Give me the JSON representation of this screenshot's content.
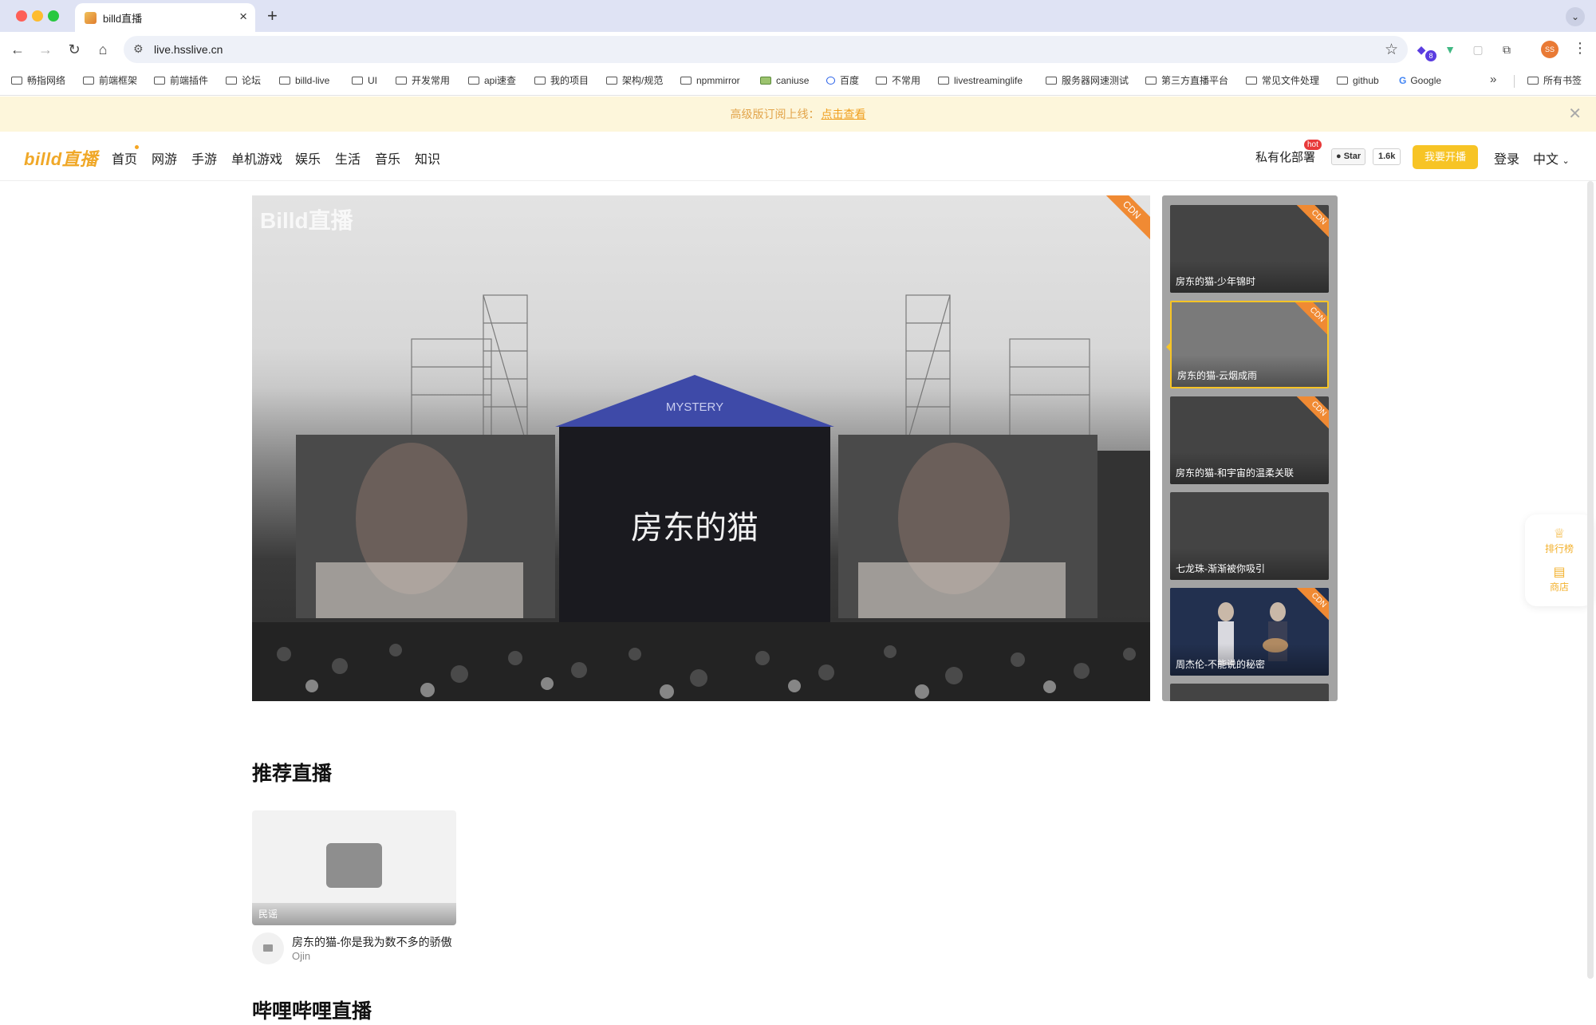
{
  "browser": {
    "tab_title": "billd直播",
    "url": "live.hsslive.cn",
    "ext_badge": "8",
    "profile_initials": "SS",
    "bookmarks": [
      "畅指网络",
      "前端框架",
      "前端插件",
      "论坛",
      "billd-live",
      "UI",
      "开发常用",
      "api速查",
      "我的项目",
      "架构/规范",
      "npmmirror",
      "caniuse",
      "百度",
      "不常用",
      "livestreaminglife",
      "服务器网速测试",
      "第三方直播平台",
      "常见文件处理",
      "github",
      "Google"
    ],
    "all_bookmarks": "所有书签"
  },
  "notice": {
    "text": "高级版订阅上线：",
    "link": "点击查看"
  },
  "header": {
    "logo": "billd直播",
    "nav": [
      "首页",
      "网游",
      "手游",
      "单机游戏",
      "娱乐",
      "生活",
      "音乐",
      "知识"
    ],
    "private_deploy": "私有化部署",
    "hot": "hot",
    "github_star": "Star",
    "github_count": "1.6k",
    "go_live": "我要开播",
    "login": "登录",
    "language": "中文"
  },
  "player": {
    "watermark": "Billd直播",
    "cdn": "CDN",
    "stage_sign": "MYSTERY",
    "screen_text": "房东的猫"
  },
  "side_list": [
    {
      "title": "房东的猫-少年锦时",
      "cdn": "CDN",
      "active": false
    },
    {
      "title": "房东的猫-云烟成雨",
      "cdn": "CDN",
      "active": true
    },
    {
      "title": "房东的猫-和宇宙的温柔关联",
      "cdn": "CDN",
      "active": false
    },
    {
      "title": "七龙珠-渐渐被你吸引",
      "cdn": "",
      "active": false
    },
    {
      "title": "周杰伦-不能说的秘密",
      "cdn": "CDN",
      "active": false
    }
  ],
  "float_panel": {
    "rank": "排行榜",
    "shop": "商店"
  },
  "recommend": {
    "title": "推荐直播",
    "card": {
      "tag": "民谣",
      "title": "房东的猫-你是我为数不多的骄傲",
      "author": "Ojin"
    }
  },
  "bilibili": {
    "title": "哔哩哔哩直播"
  }
}
